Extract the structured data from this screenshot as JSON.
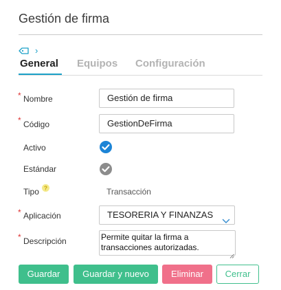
{
  "header": {
    "title": "Gestión de firma"
  },
  "breadcrumb": {
    "separator": "›"
  },
  "tabs": [
    {
      "label": "General",
      "active": true
    },
    {
      "label": "Equipos",
      "active": false
    },
    {
      "label": "Configuración",
      "active": false
    }
  ],
  "form": {
    "required_mark": "*",
    "nombre": {
      "label": "Nombre",
      "value": "Gestión de firma",
      "required": true
    },
    "codigo": {
      "label": "Código",
      "value": "GestionDeFirma",
      "required": true
    },
    "activo": {
      "label": "Activo",
      "checked": true
    },
    "estandar": {
      "label": "Estándar",
      "checked": true,
      "disabled": true
    },
    "tipo": {
      "label": "Tipo",
      "help": "?",
      "value": "Transacción"
    },
    "aplicacion": {
      "label": "Aplicación",
      "value": "TESORERIA Y FINANZAS",
      "required": true
    },
    "descripcion": {
      "label": "Descripción",
      "value": "Permite quitar la firma a transacciones autorizadas.",
      "required": true
    }
  },
  "actions": {
    "save_label": "Guardar",
    "save_new_label": "Guardar y nuevo",
    "delete_label": "Eliminar",
    "close_label": "Cerrar"
  },
  "colors": {
    "accent": "#1aa0c8",
    "primary_button": "#3fbf8c",
    "danger_button": "#f0708a",
    "check_active": "#1c84d6",
    "check_disabled": "#8c8c8c",
    "required": "#dd3333"
  }
}
